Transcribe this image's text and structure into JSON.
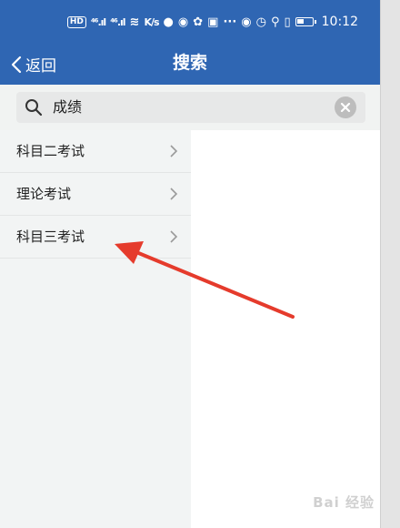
{
  "status_bar": {
    "hd_label": "HD",
    "signal1": "⁴⁶.ıl",
    "signal2": "⁴⁶.ıl",
    "speed": "K/s",
    "time": "10:12"
  },
  "nav": {
    "back_label": "返回",
    "title": "搜索"
  },
  "search": {
    "query": "成绩"
  },
  "results": [
    {
      "label": "科目二考试"
    },
    {
      "label": "理论考试"
    },
    {
      "label": "科目三考试"
    }
  ],
  "watermark": "Bai 经验",
  "colors": {
    "header": "#2f66b3",
    "annotation_arrow": "#e53b2c"
  }
}
